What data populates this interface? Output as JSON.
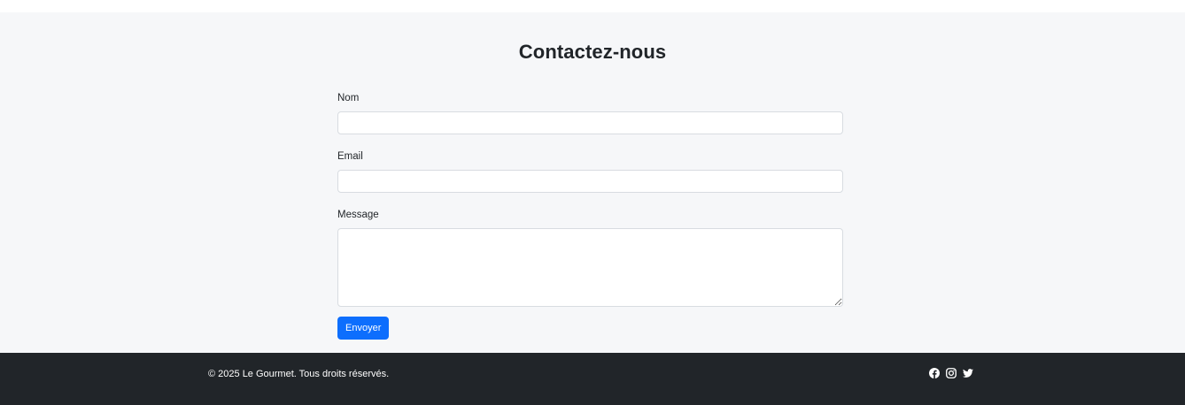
{
  "contact": {
    "title": "Contactez-nous",
    "fields": {
      "name": {
        "label": "Nom",
        "value": "",
        "placeholder": ""
      },
      "email": {
        "label": "Email",
        "value": "",
        "placeholder": ""
      },
      "message": {
        "label": "Message",
        "value": "",
        "placeholder": ""
      }
    },
    "submit_label": "Envoyer"
  },
  "footer": {
    "copyright": "© 2025 Le Gourmet. Tous droits réservés.",
    "social": [
      {
        "icon": "facebook-icon"
      },
      {
        "icon": "instagram-icon"
      },
      {
        "icon": "twitter-icon"
      }
    ]
  },
  "colors": {
    "accent": "#0d6efd",
    "footer_bg": "#212529",
    "section_bg": "#f6f7f9"
  }
}
